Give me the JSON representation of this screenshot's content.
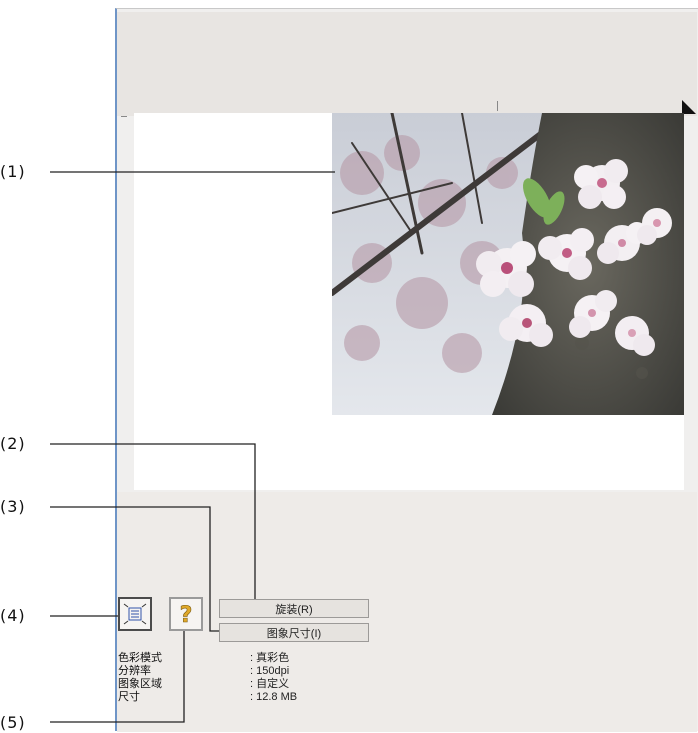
{
  "callouts": [
    "(1)",
    "(2)",
    "(3)",
    "(4)",
    "(5)"
  ],
  "buttons": {
    "rotate_label": "旋装(R)",
    "image_size_label": "图象尺寸(I)"
  },
  "info": [
    {
      "label": "色彩模式",
      "value": ": 真彩色"
    },
    {
      "label": "分辨率",
      "value": ": 150dpi"
    },
    {
      "label": "图象区域",
      "value": ": 自定义"
    },
    {
      "label": "尺寸",
      "value": ": 12.8 MB"
    }
  ],
  "icons": {
    "fit": "fit-to-window-icon",
    "help": "help-question-icon"
  },
  "colors": {
    "accent": "#6f95c7",
    "panel": "#f0efee",
    "help_icon": "#e0a92a"
  }
}
